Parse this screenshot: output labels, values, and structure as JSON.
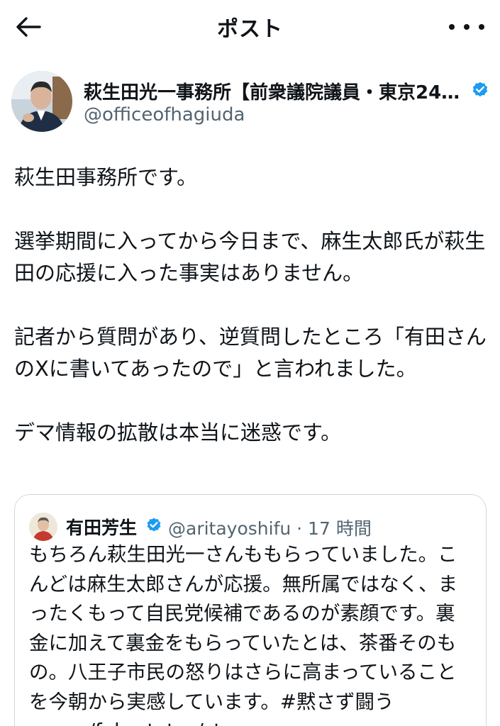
{
  "topbar": {
    "title": "ポスト",
    "back_icon": "arrow-left-icon",
    "more_icon": "more-horizontal-icon"
  },
  "author": {
    "display_name": "萩生田光一事務所【前衆議院議員・東京24…",
    "handle": "@officeofhagiuda",
    "verified_color": "#1d9bf0"
  },
  "post": {
    "paragraphs": [
      "萩生田事務所です。",
      "選挙期間に入ってから今日まで、麻生太郎氏が萩生田の応援に入った事実はありません。",
      "記者から質問があり、逆質問したところ「有田さんのXに書いてあったので」と言われました。",
      "デマ情報の拡散は本当に迷惑です。"
    ]
  },
  "quote": {
    "name": "有田芳生",
    "handle_time": "@aritayoshifu · 17 時間",
    "text": "もちろん萩生田光一さんももらっていました。こんどは麻生太郎さんが応援。無所属ではなく、まったくもって自民党候補であるのが素顔です。裏金に加えて裏金をもらっていたとは、茶番そのもの。八王子市民の怒りはさらに高まっていることを今朝から実感しています。#黙さず闘う x.com/fuku_tetsu/sta..."
  },
  "colors": {
    "text": "#0f1419",
    "secondary": "#536471",
    "border": "#cfd9de",
    "accent": "#1d9bf0"
  }
}
